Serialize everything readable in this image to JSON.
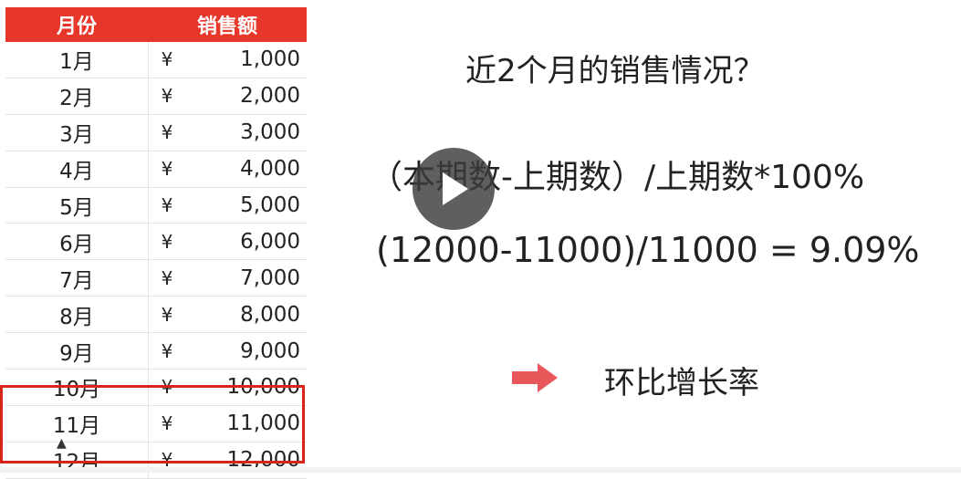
{
  "table": {
    "header": {
      "month": "月份",
      "sales": "销售额"
    },
    "currency_symbol": "¥",
    "rows": [
      {
        "month": "1月",
        "amount": "1,000"
      },
      {
        "month": "2月",
        "amount": "2,000"
      },
      {
        "month": "3月",
        "amount": "3,000"
      },
      {
        "month": "4月",
        "amount": "4,000"
      },
      {
        "month": "5月",
        "amount": "5,000"
      },
      {
        "month": "6月",
        "amount": "6,000"
      },
      {
        "month": "7月",
        "amount": "7,000"
      },
      {
        "month": "8月",
        "amount": "8,000"
      },
      {
        "month": "9月",
        "amount": "9,000"
      },
      {
        "month": "10月",
        "amount": "10,000"
      },
      {
        "month": "11月",
        "amount": "11,000"
      },
      {
        "month": "12月",
        "amount": "12,000"
      }
    ]
  },
  "slide": {
    "question": "近2个月的销售情况？",
    "formula": "（本期数-上期数）/上期数*100%",
    "calculation": "(12000-11000)/11000 = 9.09%",
    "result_label": "环比增长率"
  },
  "colors": {
    "header_bg": "#e7362a",
    "highlight": "#d9241b",
    "arrow": "#e8575a"
  },
  "icons": {
    "play": "play-icon",
    "arrow": "arrow-right-icon"
  }
}
